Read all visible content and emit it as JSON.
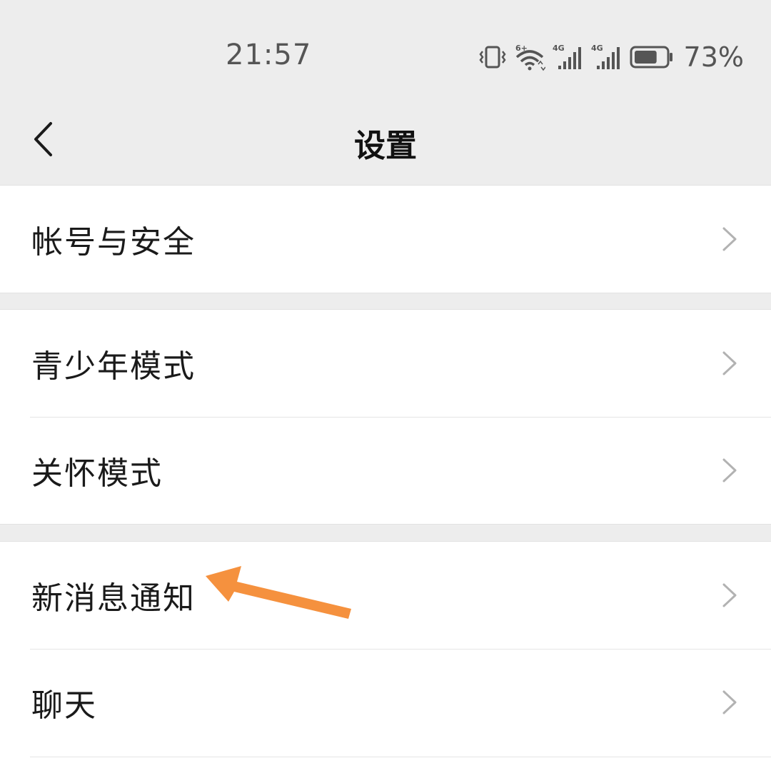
{
  "status_bar": {
    "time": "21:57",
    "battery_percent": "73%",
    "battery_level": 0.73,
    "icons": [
      "vibrate-icon",
      "wifi-6-icon",
      "signal-4g-icon",
      "signal-4g-icon",
      "battery-icon"
    ]
  },
  "nav": {
    "title": "设置",
    "back_icon": "chevron-left-icon"
  },
  "groups": [
    {
      "items": [
        {
          "label": "帐号与安全"
        }
      ]
    },
    {
      "items": [
        {
          "label": "青少年模式"
        },
        {
          "label": "关怀模式"
        }
      ]
    },
    {
      "items": [
        {
          "label": "新消息通知"
        },
        {
          "label": "聊天"
        }
      ]
    }
  ],
  "annotation": {
    "color": "#f5913e",
    "target": "新消息通知"
  },
  "colors": {
    "background": "#ededed",
    "card": "#ffffff",
    "chevron": "#b2b2b2",
    "text": "#1a1a1a"
  }
}
